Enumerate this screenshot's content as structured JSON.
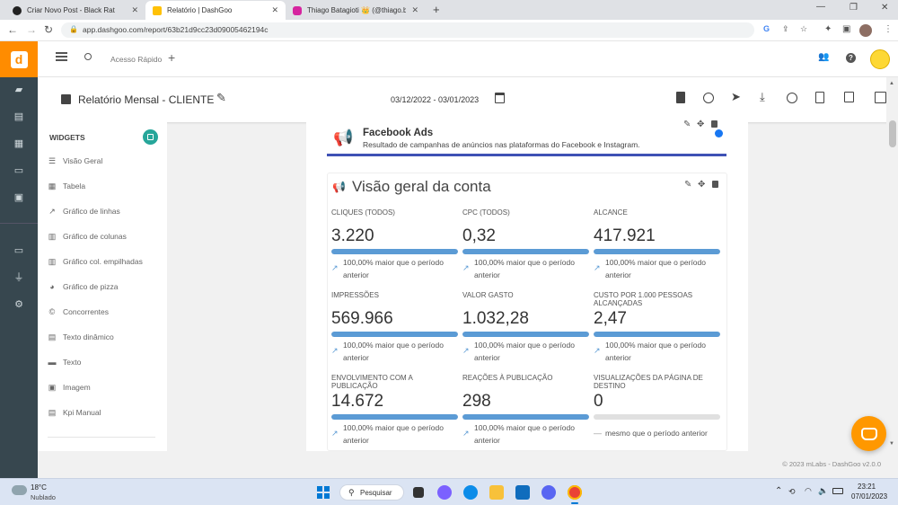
{
  "browser": {
    "tabs": [
      {
        "title": "Criar Novo Post - Black Rat",
        "active": false
      },
      {
        "title": "Relatório | DashGoo",
        "active": true
      },
      {
        "title": "Thiago Batagioti 👑 (@thiago.ba",
        "active": false
      }
    ],
    "url": "app.dashgoo.com/report/63b21d9cc23d09005462194c"
  },
  "appbar": {
    "quick_access": "Acesso Rápido"
  },
  "report": {
    "title": "Relatório Mensal - CLIENTE",
    "date_range": "03/12/2022 - 03/01/2023"
  },
  "widgets": {
    "header": "WIDGETS",
    "items": [
      {
        "label": "Visão Geral",
        "icon": "list-icon"
      },
      {
        "label": "Tabela",
        "icon": "table-icon"
      },
      {
        "label": "Gráfico de linhas",
        "icon": "trend-icon"
      },
      {
        "label": "Gráfico de colunas",
        "icon": "column-chart-icon"
      },
      {
        "label": "Gráfico col. empilhadas",
        "icon": "stacked-chart-icon"
      },
      {
        "label": "Gráfico de pizza",
        "icon": "pie-chart-icon"
      },
      {
        "label": "Concorrentes",
        "icon": "copyright-icon"
      },
      {
        "label": "Texto dinâmico",
        "icon": "dynamic-text-icon"
      },
      {
        "label": "Texto",
        "icon": "comment-icon"
      },
      {
        "label": "Imagem",
        "icon": "image-icon"
      },
      {
        "label": "Kpi Manual",
        "icon": "kpi-icon"
      }
    ]
  },
  "facebook_card": {
    "title": "Facebook Ads",
    "subtitle": "Resultado de campanhas de anúncios nas plataformas do Facebook e Instagram."
  },
  "overview": {
    "title": "Visão geral da conta",
    "kpis": [
      {
        "label": "CLIQUES (TODOS)",
        "value": "3.220",
        "progress": 100,
        "trend": "100,00% maior que o período anterior"
      },
      {
        "label": "CPC (TODOS)",
        "value": "0,32",
        "progress": 100,
        "trend": "100,00% maior que o período anterior"
      },
      {
        "label": "ALCANCE",
        "value": "417.921",
        "progress": 100,
        "trend": "100,00% maior que o período anterior"
      },
      {
        "label": "IMPRESSÕES",
        "value": "569.966",
        "progress": 100,
        "trend": "100,00% maior que o período anterior"
      },
      {
        "label": "VALOR GASTO",
        "value": "1.032,28",
        "progress": 100,
        "trend": "100,00% maior que o período anterior"
      },
      {
        "label": "CUSTO POR 1.000 PESSOAS ALCANÇADAS",
        "value": "2,47",
        "progress": 100,
        "trend": "100,00% maior que o período anterior"
      },
      {
        "label": "ENVOLVIMENTO COM A PUBLICAÇÃO",
        "value": "14.672",
        "progress": 100,
        "trend": "100,00% maior que o período anterior"
      },
      {
        "label": "REAÇÕES À PUBLICAÇÃO",
        "value": "298",
        "progress": 100,
        "trend": "100,00% maior que o período anterior"
      },
      {
        "label": "VISUALIZAÇÕES DA PÁGINA DE DESTINO",
        "value": "0",
        "progress": 0,
        "trend": "mesmo que o período anterior"
      }
    ]
  },
  "footer": {
    "copyright": "© 2023 mLabs - DashGoo  v2.0.0"
  },
  "taskbar": {
    "weather_temp": "18°C",
    "weather_desc": "Nublado",
    "search_label": "Pesquisar",
    "time": "23:21",
    "date": "07/01/2023"
  },
  "colors": {
    "brand_orange": "#ff8c00",
    "rail": "#37474f",
    "facebook_bar": "#3f51b5",
    "progress_fill": "#5b9bd5",
    "widgets_badge": "#26a69a"
  }
}
